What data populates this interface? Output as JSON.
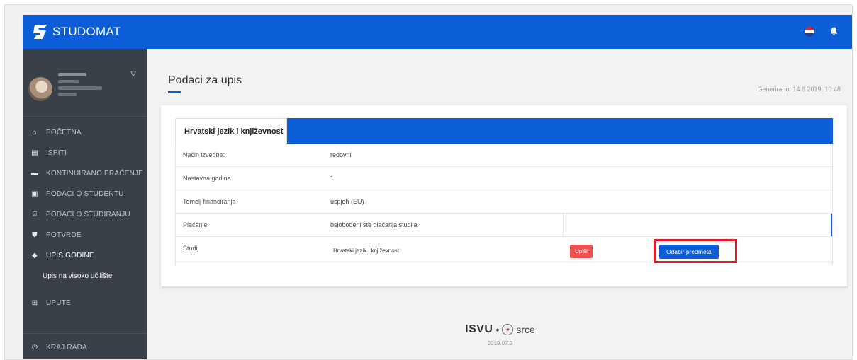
{
  "app": {
    "name": "STUDOMAT"
  },
  "sidebar": {
    "items": [
      {
        "icon": "home-icon",
        "glyph": "🏠",
        "label": "POČETNA"
      },
      {
        "icon": "exam-icon",
        "glyph": "📋",
        "label": "ISPITI"
      },
      {
        "icon": "list-icon",
        "glyph": "☰",
        "label": "KONTINUIRANO PRAĆENJE"
      },
      {
        "icon": "id-card-icon",
        "glyph": "▣",
        "label": "PODACI O STUDENTU"
      },
      {
        "icon": "university-icon",
        "glyph": "🏛",
        "label": "PODACI O STUDIRANJU"
      },
      {
        "icon": "shield-icon",
        "glyph": "⛊",
        "label": "POTVRDE"
      },
      {
        "icon": "graduation-cap-icon",
        "glyph": "🎓",
        "label": "UPIS GODINE"
      }
    ],
    "sub_item": "Upis na visoko učilište",
    "upute": {
      "label": "UPUTE"
    },
    "logout": {
      "label": "KRAJ RADA"
    }
  },
  "main": {
    "title": "Podaci za upis",
    "generated": "Generirano: 14.8.2019. 10:48",
    "card_tab": "Hrvatski jezik i književnost",
    "rows": [
      {
        "label": "Način izvedbe:",
        "value": "redovni"
      },
      {
        "label": "Nastavna godina",
        "value": "1"
      },
      {
        "label": "Temelj financiranja",
        "value": "uspjeh (EU)"
      },
      {
        "label": "Plaćanje",
        "value": "oslobođeni ste plaćanja studija"
      }
    ],
    "studij": {
      "label": "Studij",
      "value": "Hrvatski jezik i književnost",
      "upisi_button": "Upiši",
      "odabir_button": "Odabir predmeta"
    }
  },
  "footer": {
    "isvu": "ISVU",
    "separator": "•",
    "srce": "srce",
    "version": "2019.07.3"
  },
  "colors": {
    "primary": "#0b5ed7",
    "danger": "#f05050",
    "sidebar": "#3a4048",
    "highlight": "#e31d2b"
  }
}
